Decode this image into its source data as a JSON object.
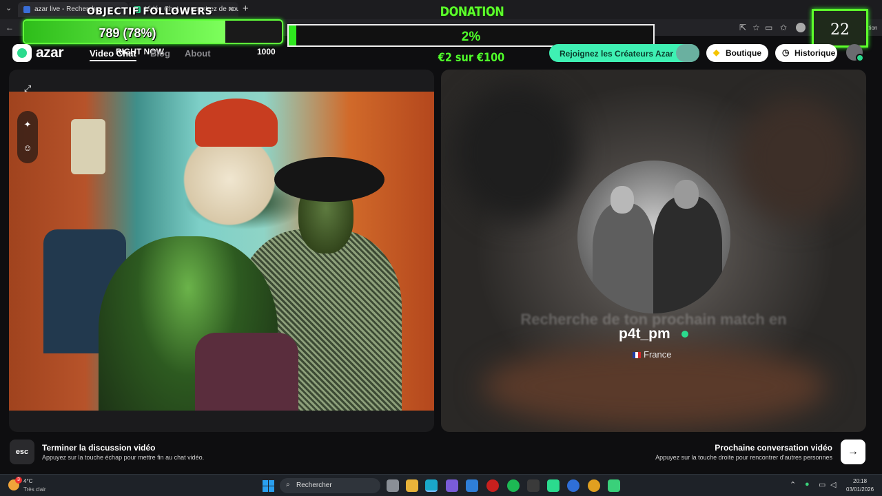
{
  "browser": {
    "tabs": [
      {
        "title": "azar live - Recherche",
        "active": true
      },
      {
        "title": "Vidéo Chat : rencontrez de nou",
        "active": false
      }
    ],
    "extension_label": "onversation"
  },
  "overlay": {
    "followers": {
      "title": "OBJECTIF FOLLOWERS",
      "progress_text": "789 (78%)",
      "progress_fraction": 0.78,
      "subtitle": "RIGHT NOW",
      "goal": "1000"
    },
    "donation": {
      "title": "DONATION",
      "percent_text": "2%",
      "progress_fraction": 0.02,
      "amount_text": "€2 sur €100"
    },
    "counter": "22"
  },
  "azar": {
    "logo_text": "azar",
    "nav": [
      {
        "label": "Video Chat",
        "active": true
      },
      {
        "label": "Blog",
        "active": false
      },
      {
        "label": "About",
        "active": false
      }
    ],
    "creators_button": "Rejoignez les Créateurs Azar",
    "shop_button": "Boutique",
    "history_button": "Historique",
    "remote": {
      "search_message": "Recherche de ton prochain match en",
      "username": "p4t_pm",
      "country": "France"
    },
    "actions": {
      "esc_key": "esc",
      "end_title": "Terminer la discussion vidéo",
      "end_subtitle": "Appuyez sur la touche échap pour mettre fin au chat vidéo.",
      "next_title": "Prochaine conversation vidéo",
      "next_subtitle": "Appuyez sur la touche droite pour rencontrer d'autres personnes"
    }
  },
  "taskbar": {
    "temperature": "4°C",
    "condition": "Très clair",
    "search_placeholder": "Rechercher",
    "time": "20:18",
    "date": "03/01/2026"
  },
  "colors": {
    "overlay_green": "#5dff2b",
    "azar_mint": "#3ff0b3",
    "windows_blue": "#2aa0f0"
  }
}
